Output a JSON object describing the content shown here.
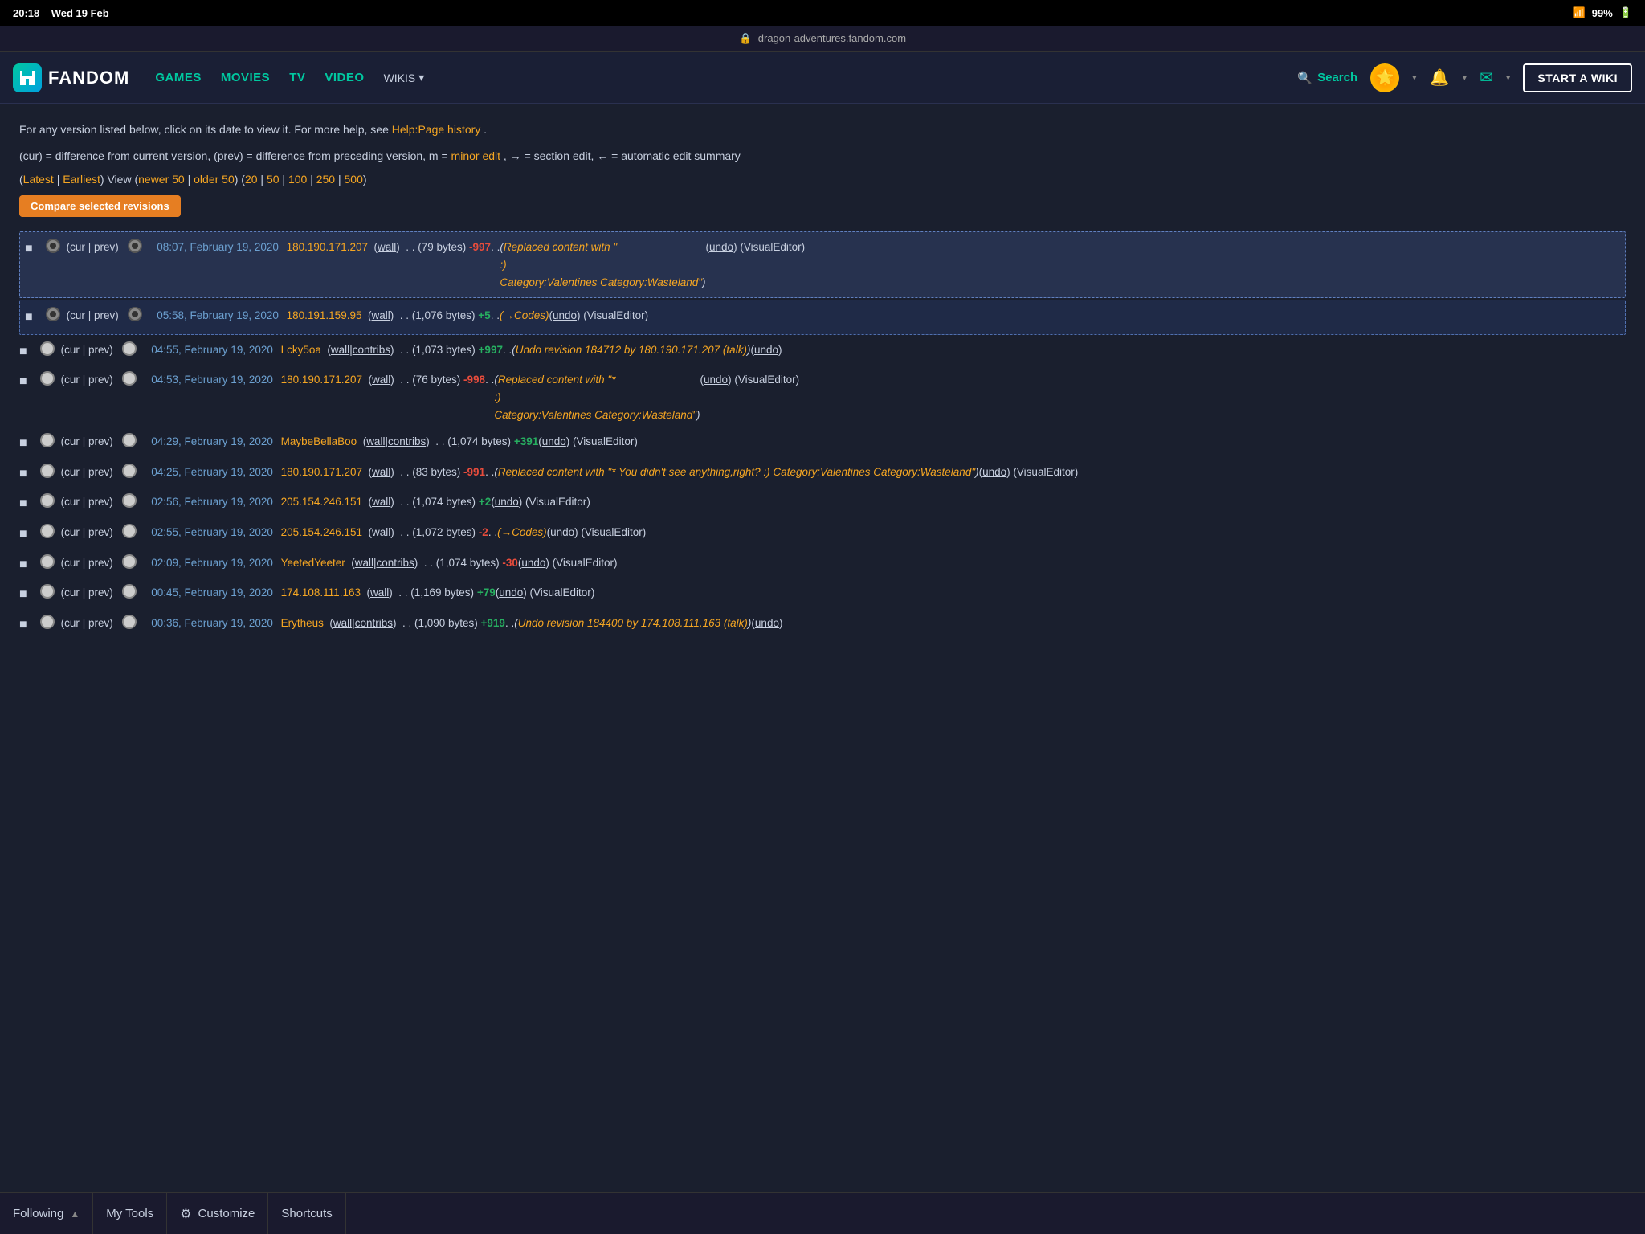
{
  "statusBar": {
    "time": "20:18",
    "date": "Wed 19 Feb",
    "wifi": "▲",
    "battery": "99%",
    "batteryIcon": "🔋"
  },
  "urlBar": {
    "lockIcon": "🔒",
    "url": "dragon-adventures.fandom.com"
  },
  "nav": {
    "logoChar": "F",
    "logoText": "FANDOM",
    "links": {
      "games": "GAMES",
      "movies": "MOVIES",
      "tv": "TV",
      "video": "VIDEO",
      "wikis": "WIKIS"
    },
    "search": "Search",
    "startWiki": "START A WIKI"
  },
  "content": {
    "infoLine1": "For any version listed below, click on its date to view it. For more help, see",
    "helpLink": "Help:Page history",
    "infoLine1End": ".",
    "infoLine2": "(cur) = difference from current version, (prev) = difference from preceding version, m =",
    "minorEdit": "minor edit",
    "infoLine2b": ", → = section edit, ← = automatic edit summary",
    "viewLine": "(Latest | Earliest) View (newer 50 | older 50) (20 | 50 | 100 | 250 | 500)",
    "compareBtn": "Compare selected revisions",
    "revisions": [
      {
        "id": "r1",
        "selected": "selected-1",
        "radioSelected": true,
        "curPrev": "(cur | prev)",
        "timestamp": "08:07, February 19, 2020",
        "user": "180.190.171.207",
        "userType": "ip",
        "wall": "wall",
        "bytes": "79 bytes",
        "diff": "-997",
        "diffType": "neg",
        "summary": "Replaced content with \"<blockquote>:)</blockquote> Category:Valentines Category:Wasteland\"",
        "undo": "undo",
        "editor": "VisualEditor"
      },
      {
        "id": "r2",
        "selected": "selected-2",
        "radioSelected": true,
        "curPrev": "(cur | prev)",
        "timestamp": "05:58, February 19, 2020",
        "user": "180.191.159.95",
        "userType": "ip",
        "wall": "wall",
        "bytes": "1,076 bytes",
        "diff": "+5",
        "diffType": "pos",
        "summary": "(→Codes)",
        "undo": "undo",
        "editor": "VisualEditor"
      },
      {
        "id": "r3",
        "selected": "",
        "radioSelected": false,
        "curPrev": "(cur | prev)",
        "timestamp": "04:55, February 19, 2020",
        "user": "Lcky5oa",
        "userType": "username",
        "wall": "wall",
        "contribs": "contribs",
        "bytes": "1,073 bytes",
        "diff": "+997",
        "diffType": "pos",
        "summary": "Undo revision 184712 by 180.190.171.207 (talk)",
        "undo": "undo"
      },
      {
        "id": "r4",
        "selected": "",
        "radioSelected": false,
        "curPrev": "(cur | prev)",
        "timestamp": "04:53, February 19, 2020",
        "user": "180.190.171.207",
        "userType": "ip",
        "wall": "wall",
        "bytes": "76 bytes",
        "diff": "-998",
        "diffType": "neg",
        "summary": "Replaced content with \"* <blockquote>:)</blockquote> Category:Valentines Category:Wasteland\"",
        "undo": "undo",
        "editor": "VisualEditor"
      },
      {
        "id": "r5",
        "selected": "",
        "radioSelected": false,
        "curPrev": "(cur | prev)",
        "timestamp": "04:29, February 19, 2020",
        "user": "MaybeBellaBoo",
        "userType": "username",
        "wall": "wall",
        "contribs": "contribs",
        "bytes": "1,074 bytes",
        "diff": "+391",
        "diffType": "pos",
        "summary": "",
        "undo": "undo",
        "editor": "VisualEditor"
      },
      {
        "id": "r6",
        "selected": "",
        "radioSelected": false,
        "curPrev": "(cur | prev)",
        "timestamp": "04:25, February 19, 2020",
        "user": "180.190.171.207",
        "userType": "ip",
        "wall": "wall",
        "bytes": "83 bytes",
        "diff": "-991",
        "diffType": "neg",
        "summary": "Replaced content with \"* You didn't see anything,right? :) Category:Valentines Category:Wasteland\"",
        "undo": "undo",
        "editor": "VisualEditor"
      },
      {
        "id": "r7",
        "selected": "",
        "radioSelected": false,
        "curPrev": "(cur | prev)",
        "timestamp": "02:56, February 19, 2020",
        "user": "205.154.246.151",
        "userType": "ip",
        "wall": "wall",
        "bytes": "1,074 bytes",
        "diff": "+2",
        "diffType": "pos",
        "summary": "",
        "undo": "undo",
        "editor": "VisualEditor"
      },
      {
        "id": "r8",
        "selected": "",
        "radioSelected": false,
        "curPrev": "(cur | prev)",
        "timestamp": "02:55, February 19, 2020",
        "user": "205.154.246.151",
        "userType": "ip",
        "wall": "wall",
        "bytes": "1,072 bytes",
        "diff": "-2",
        "diffType": "neg",
        "summary": "(→Codes)",
        "undo": "undo",
        "editor": "VisualEditor"
      },
      {
        "id": "r9",
        "selected": "",
        "radioSelected": false,
        "curPrev": "(cur | prev)",
        "timestamp": "02:09, February 19, 2020",
        "user": "YeetedYeeter",
        "userType": "username",
        "wall": "wall",
        "contribs": "contribs",
        "bytes": "1,074 bytes",
        "diff": "-30",
        "diffType": "neg",
        "summary": "",
        "undo": "undo",
        "editor": "VisualEditor"
      },
      {
        "id": "r10",
        "selected": "",
        "radioSelected": false,
        "curPrev": "(cur | prev)",
        "timestamp": "00:45, February 19, 2020",
        "user": "174.108.111.163",
        "userType": "ip",
        "wall": "wall",
        "bytes": "1,169 bytes",
        "diff": "+79",
        "diffType": "pos",
        "summary": "",
        "undo": "undo",
        "editor": "VisualEditor"
      },
      {
        "id": "r11",
        "selected": "",
        "radioSelected": false,
        "curPrev": "(cur | prev)",
        "timestamp": "00:36, February 19, 2020",
        "user": "Erytheus",
        "userType": "username",
        "wall": "wall",
        "contribs": "contribs",
        "bytes": "1,090 bytes",
        "diff": "+919",
        "diffType": "pos",
        "summary": "Undo revision 184400 by 174.108.111.163 (talk)",
        "undo": "undo"
      }
    ]
  },
  "bottomToolbar": {
    "following": "Following",
    "chevronUp": "▲",
    "myTools": "My Tools",
    "customize": "Customize",
    "shortcuts": "Shortcuts",
    "gearIcon": "⚙"
  }
}
